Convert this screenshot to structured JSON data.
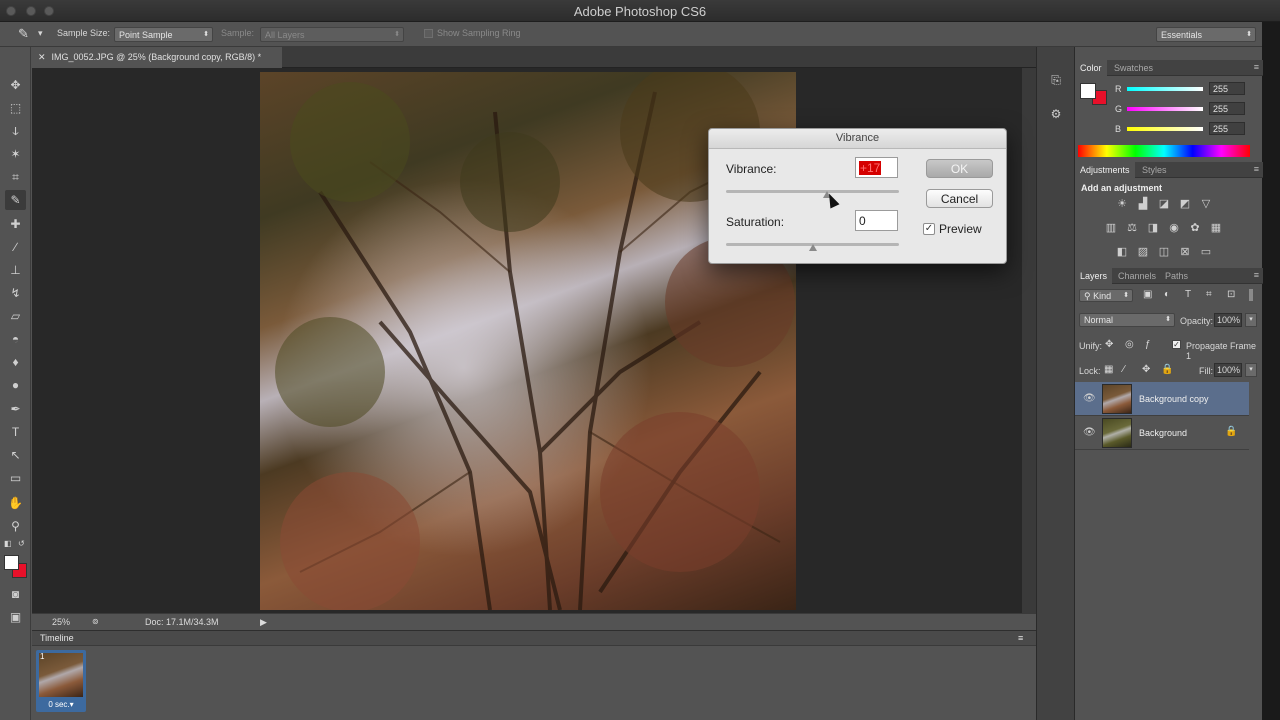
{
  "window": {
    "title": "Adobe Photoshop CS6"
  },
  "options_bar": {
    "sample_size_label": "Sample Size:",
    "sample_size_value": "Point Sample",
    "sample_label": "Sample:",
    "sample_value": "All Layers",
    "show_ring_label": "Show Sampling Ring",
    "workspace": "Essentials"
  },
  "document": {
    "tab_title": "IMG_0052.JPG @ 25% (Background copy, RGB/8) *",
    "zoom": "25%",
    "doc_size": "Doc: 17.1M/34.3M"
  },
  "timeline": {
    "label": "Timeline",
    "frame_number": "1",
    "frame_duration": "0 sec.▾"
  },
  "color_panel": {
    "tabs": [
      "Color",
      "Swatches"
    ],
    "r_label": "R",
    "g_label": "G",
    "b_label": "B",
    "r_value": "255",
    "g_value": "255",
    "b_value": "255"
  },
  "adjustments_panel": {
    "tabs": [
      "Adjustments",
      "Styles"
    ],
    "heading": "Add an adjustment"
  },
  "layers_panel": {
    "tabs": [
      "Layers",
      "Channels",
      "Paths"
    ],
    "kind_label": "Kind",
    "blend_mode": "Normal",
    "opacity_label": "Opacity:",
    "opacity_value": "100%",
    "unify_label": "Unify:",
    "propagate_label": "Propagate Frame 1",
    "lock_label": "Lock:",
    "fill_label": "Fill:",
    "fill_value": "100%",
    "layers": [
      {
        "name": "Background copy",
        "selected": true
      },
      {
        "name": "Background",
        "selected": false
      }
    ]
  },
  "dialog": {
    "title": "Vibrance",
    "vibrance_label": "Vibrance:",
    "vibrance_value": "+17",
    "vibrance_level": 17,
    "saturation_label": "Saturation:",
    "saturation_value": "0",
    "saturation_level": 0,
    "ok_label": "OK",
    "cancel_label": "Cancel",
    "preview_label": "Preview",
    "preview_checked": true
  },
  "colors": {
    "background": "#535353",
    "foreground_swatch": "#ffffff",
    "background_swatch": "#e8102a",
    "selected_layer": "#5b6e8c"
  }
}
